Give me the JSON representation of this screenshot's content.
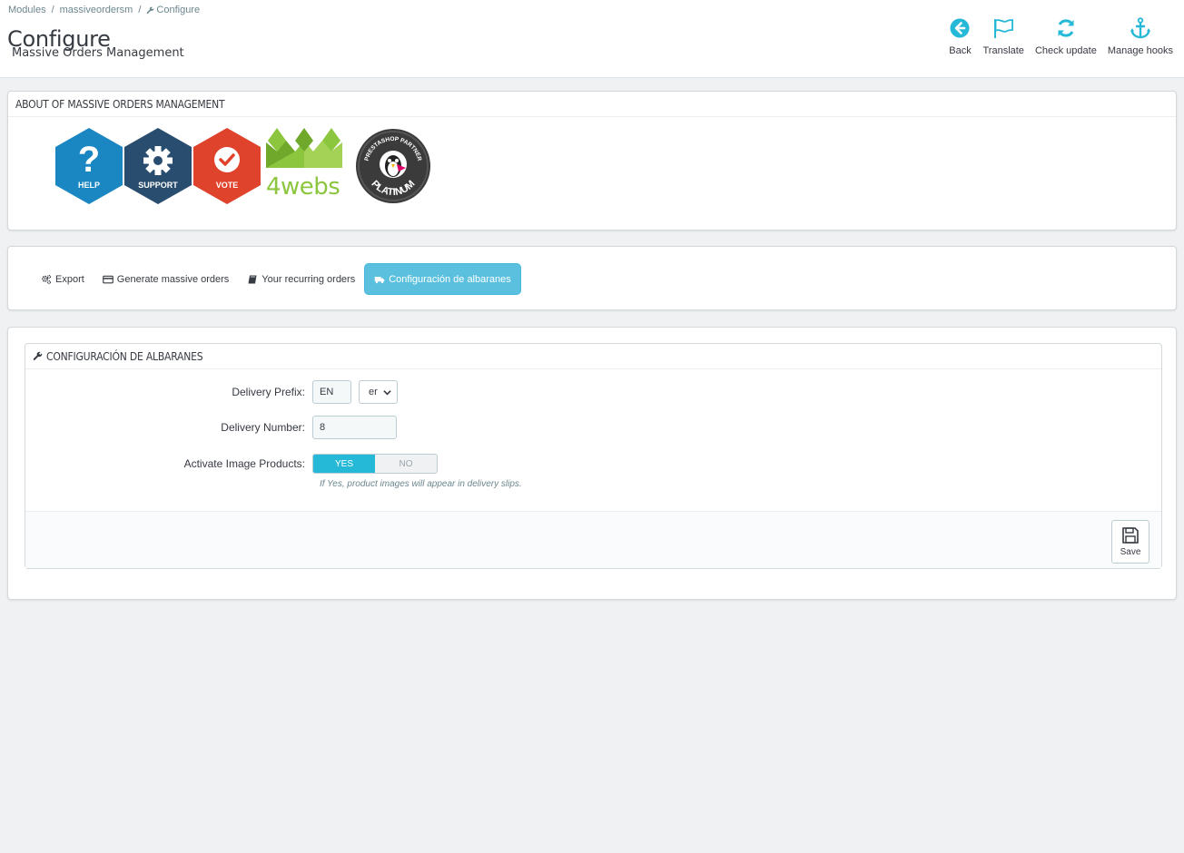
{
  "breadcrumb": {
    "items": [
      "Modules",
      "massiveordersm",
      "Configure"
    ],
    "separator": "/"
  },
  "header": {
    "title": "Configure",
    "subtitle": "Massive Orders Management"
  },
  "toolbar": {
    "back": "Back",
    "translate": "Translate",
    "check_update": "Check update",
    "manage_hooks": "Manage hooks"
  },
  "about": {
    "heading": "About of Massive Orders Management",
    "logos": {
      "help": "HELP",
      "support": "SUPPORT",
      "vote": "VOTE",
      "brand": "4webs",
      "partner_top": "PRESTASHOP PARTNER",
      "partner_bottom": "PLATINUM"
    }
  },
  "tabs": [
    {
      "label": "Export",
      "icon": "gears-icon"
    },
    {
      "label": "Generate massive orders",
      "icon": "credit-card-icon"
    },
    {
      "label": "Your recurring orders",
      "icon": "book-icon"
    },
    {
      "label": "Configuración de albaranes",
      "icon": "truck-icon",
      "active": true
    }
  ],
  "config": {
    "heading": "Configuración de albaranes",
    "delivery_prefix_label": "Delivery Prefix:",
    "delivery_prefix_value": "EN",
    "language_select": "er",
    "delivery_number_label": "Delivery Number:",
    "delivery_number_value": "8",
    "activate_images_label": "Activate Image Products:",
    "yes": "YES",
    "no": "NO",
    "help": "If Yes, product images will appear in delivery slips.",
    "save": "Save"
  },
  "colors": {
    "accent": "#25b9d7",
    "tab_active": "#5bc0de",
    "help_blue": "#1a86c2",
    "support_navy": "#294d6e",
    "vote_red": "#e0432b",
    "brand_green": "#8cc63f"
  }
}
